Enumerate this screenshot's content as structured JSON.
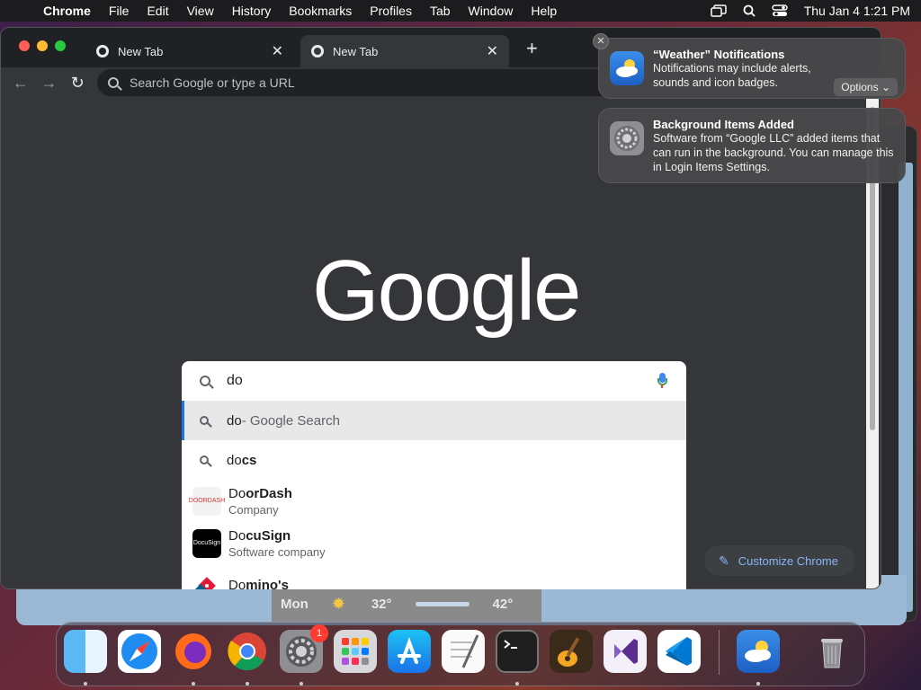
{
  "menubar": {
    "app": "Chrome",
    "items": [
      "File",
      "Edit",
      "View",
      "History",
      "Bookmarks",
      "Profiles",
      "Tab",
      "Window",
      "Help"
    ],
    "clock": "Thu Jan 4  1:21 PM",
    "icons": [
      "apple-icon",
      "screen-mirroring-icon",
      "spotlight-search-icon",
      "control-center-icon"
    ]
  },
  "chrome": {
    "tabs": [
      {
        "title": "New Tab",
        "active": false
      },
      {
        "title": "New Tab",
        "active": true
      }
    ],
    "omnibox_placeholder": "Search Google or type a URL",
    "logo_text": "Google",
    "customize_label": "Customize Chrome",
    "search": {
      "query": "do",
      "suggestions": [
        {
          "typed": "do",
          "rest": " - Google Search"
        },
        {
          "typed": "do",
          "rest": "cs"
        }
      ],
      "entities": [
        {
          "typed": "Do",
          "rest": "orDash",
          "sub": "Company",
          "icon_text": "DOORDASH"
        },
        {
          "typed": "Do",
          "rest": "cuSign",
          "sub": "Software company",
          "icon_text": "DocuSign"
        },
        {
          "typed": "Do",
          "rest": "mino's",
          "sub": ""
        }
      ]
    }
  },
  "weather_strip": {
    "day": "Mon",
    "low": "32°",
    "high": "42°"
  },
  "notifications": [
    {
      "title": "“Weather” Notifications",
      "body": "Notifications may include alerts, sounds and icon badges.",
      "button": "Options ⌄"
    },
    {
      "title": "Background Items Added",
      "body": "Software from “Google LLC” added items that can run in the background. You can manage this in Login Items Settings."
    }
  ],
  "dock": {
    "apps": [
      "Finder",
      "Safari",
      "Firefox",
      "Google Chrome",
      "System Settings",
      "Launchpad",
      "App Store",
      "TextEdit",
      "Terminal",
      "GarageBand",
      "Visual Studio",
      "Visual Studio Code"
    ],
    "extra": [
      "Weather",
      "Trash"
    ],
    "settings_badge": "1",
    "colors": {
      "chrome_bg": "#35363a",
      "tab_strip": "#202124",
      "link_blue": "#8ab4f8",
      "accent": "#1a73e8"
    }
  }
}
